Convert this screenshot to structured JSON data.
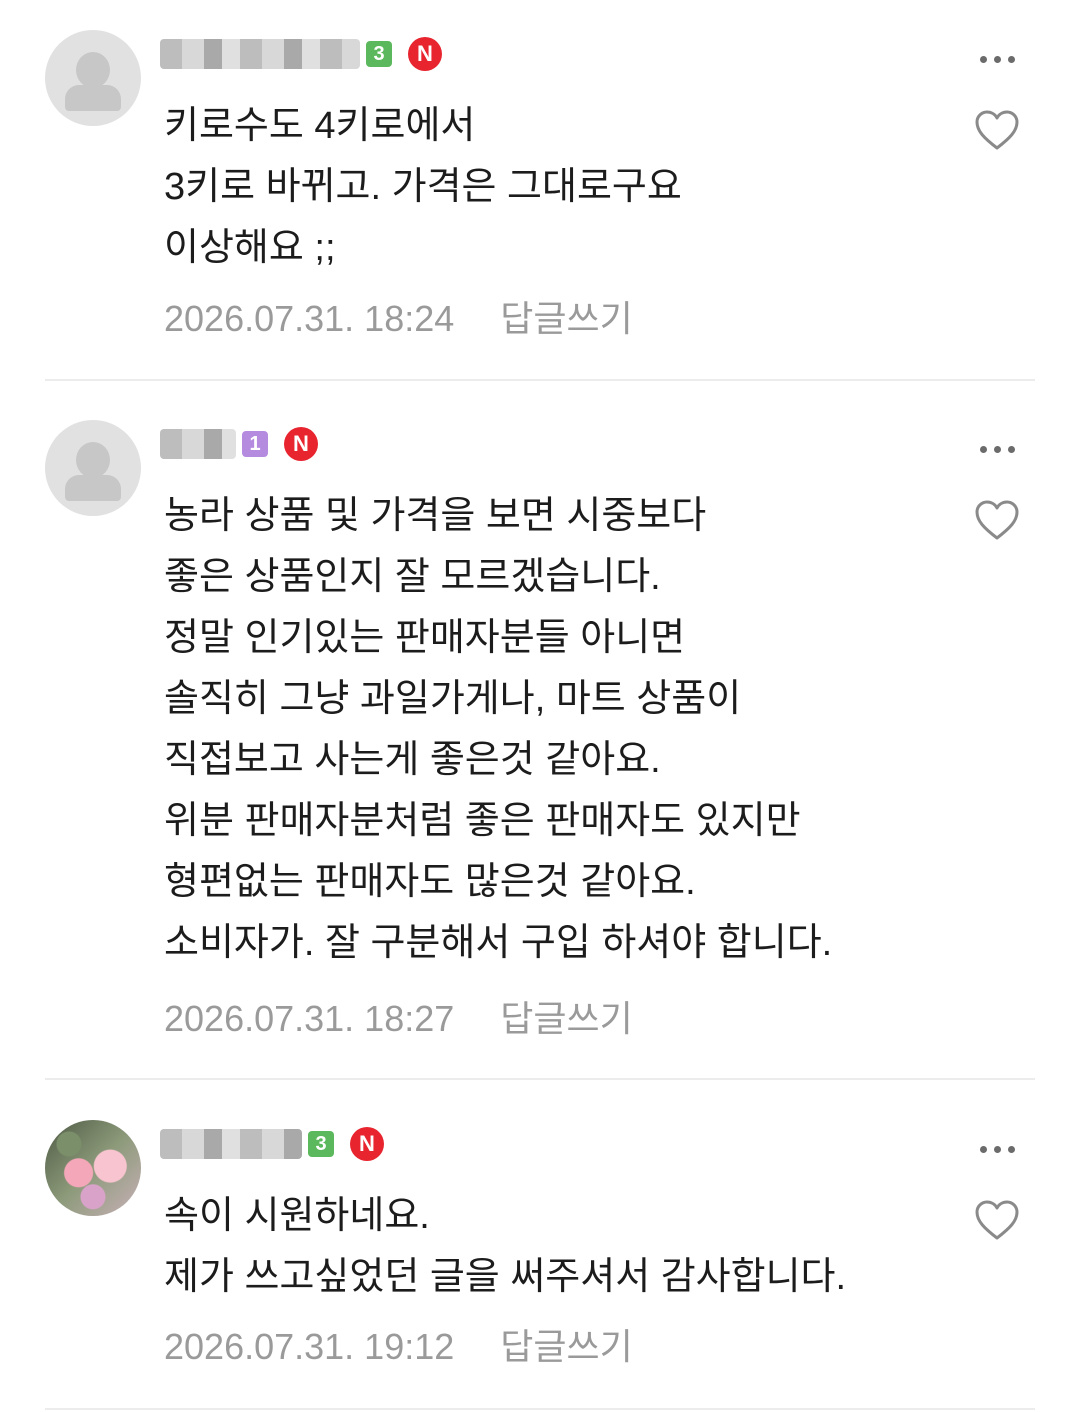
{
  "comments": [
    {
      "level": "3",
      "level_color": "#5cb85c",
      "new_badge": "N",
      "avatar": "default-avatar",
      "text_lines": [
        "키로수도 4키로에서",
        "3키로 바뀌고. 가격은 그대로구요",
        "이상해요 ;;"
      ],
      "timestamp": "2026.07.31. 18:24",
      "reply_label": "답글쓰기"
    },
    {
      "level": "1",
      "level_color": "#b58be0",
      "new_badge": "N",
      "avatar": "default-avatar",
      "text_lines": [
        "농라 상품 및 가격을 보면 시중보다",
        "좋은 상품인지 잘 모르겠습니다.",
        "정말 인기있는 판매자분들 아니면",
        "솔직히 그냥 과일가게나, 마트 상품이",
        "직접보고 사는게 좋은것 같아요.",
        "위분 판매자분처럼 좋은 판매자도 있지만",
        "형편없는 판매자도 많은것 같아요.",
        "소비자가. 잘 구분해서 구입 하셔야 합니다."
      ],
      "timestamp": "2026.07.31. 18:27",
      "reply_label": "답글쓰기"
    },
    {
      "level": "3",
      "level_color": "#5cb85c",
      "new_badge": "N",
      "avatar": "photo-avatar",
      "text_lines": [
        "속이 시원하네요.",
        "제가 쓰고싶었던 글을 써주셔서 감사합니다."
      ],
      "timestamp": "2026.07.31. 19:12",
      "reply_label": "답글쓰기"
    }
  ],
  "icons": {
    "more": "more-options-icon",
    "like": "heart-outline-icon"
  },
  "colors": {
    "new_badge": "#e8242f",
    "meta_text": "#9a9a9a",
    "divider": "#ececec"
  }
}
